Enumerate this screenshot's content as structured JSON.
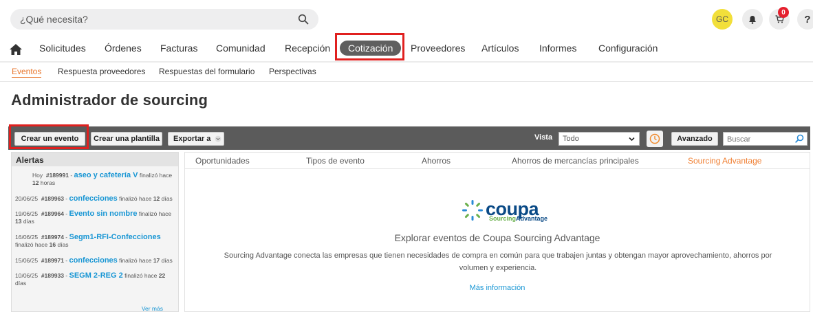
{
  "search": {
    "placeholder": "¿Qué necesita?"
  },
  "user": {
    "initials": "GC"
  },
  "cart": {
    "count": "0"
  },
  "help": {
    "label": "?"
  },
  "nav": {
    "items": [
      {
        "label": "Solicitudes"
      },
      {
        "label": "Órdenes"
      },
      {
        "label": "Facturas"
      },
      {
        "label": "Comunidad"
      },
      {
        "label": "Recepción"
      },
      {
        "label": "Cotización",
        "active": true
      },
      {
        "label": "Proveedores"
      },
      {
        "label": "Artículos"
      },
      {
        "label": "Informes"
      },
      {
        "label": "Configuración"
      }
    ]
  },
  "subnav": {
    "items": [
      {
        "label": "Eventos",
        "active": true
      },
      {
        "label": "Respuesta proveedores"
      },
      {
        "label": "Respuestas del formulario"
      },
      {
        "label": "Perspectivas"
      }
    ]
  },
  "page": {
    "title": "Administrador de sourcing"
  },
  "toolbar": {
    "create_event": "Crear un evento",
    "create_template": "Crear una plantilla",
    "export": "Exportar a",
    "vista_label": "Vista",
    "vista_value": "Todo",
    "advanced": "Avanzado",
    "search_placeholder": "Buscar"
  },
  "alerts": {
    "title": "Alertas",
    "items": [
      {
        "date": "Hoy",
        "id": "#189991",
        "name": "aseo y cafetería V",
        "status_pre": "finalizó hace",
        "num": "12",
        "unit": "horas"
      },
      {
        "date": "20/06/25",
        "id": "#189963",
        "name": "confecciones",
        "status_pre": "finalizó hace",
        "num": "12",
        "unit": "días"
      },
      {
        "date": "19/06/25",
        "id": "#189964",
        "name": "Evento sin nombre",
        "status_pre": "finalizó hace",
        "num": "13",
        "unit": "días"
      },
      {
        "date": "16/06/25",
        "id": "#189974",
        "name": "Segm1-RFI-Confecciones",
        "status_pre": "finalizó hace",
        "num": "16",
        "unit": "días"
      },
      {
        "date": "15/06/25",
        "id": "#189971",
        "name": "confecciones",
        "status_pre": "finalizó hace",
        "num": "17",
        "unit": "días"
      },
      {
        "date": "10/06/25",
        "id": "#189933",
        "name": "SEGM 2-REG 2",
        "status_pre": "finalizó hace",
        "num": "22",
        "unit": "días"
      }
    ],
    "more": "Ver más"
  },
  "tabs": {
    "items": [
      {
        "label": "Oportunidades"
      },
      {
        "label": "Tipos de evento"
      },
      {
        "label": "Ahorros"
      },
      {
        "label": "Ahorros de mercancías principales"
      },
      {
        "label": "Sourcing Advantage",
        "active": true
      }
    ]
  },
  "content": {
    "logo_text": "coupa",
    "logo_sub_1": "Sourcing",
    "logo_sub_2": "Advantage",
    "title": "Explorar eventos de Coupa Sourcing Advantage",
    "description": "Sourcing Advantage conecta las empresas que tienen necesidades de compra en común para que trabajen juntas y obtengan mayor aprovechamiento, ahorros por volumen y experiencia.",
    "more_info": "Más información"
  },
  "colors": {
    "accent_orange": "#e8762c",
    "highlight_red": "#e0201f",
    "link_blue": "#1896d4",
    "toolbar_gray": "#5b5b5b",
    "avatar_yellow": "#f2df3a",
    "coupa_blue": "#0a4a86"
  },
  "icons": {
    "search": "search-icon",
    "bell": "bell-icon",
    "cart": "cart-icon",
    "home": "home-icon",
    "clock": "clock-icon",
    "chevron": "chevron-down-icon"
  }
}
